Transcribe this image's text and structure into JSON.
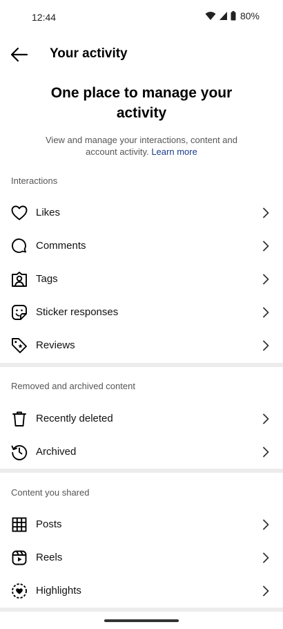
{
  "status": {
    "time": "12:44",
    "battery": "80%"
  },
  "header": {
    "title": "Your activity"
  },
  "hero": {
    "title": "One place to manage your activity",
    "description": "View and manage your interactions, content and account activity.",
    "link": "Learn more"
  },
  "sections": {
    "interactions": {
      "label": "Interactions",
      "items": [
        "Likes",
        "Comments",
        "Tags",
        "Sticker responses",
        "Reviews"
      ]
    },
    "removed": {
      "label": "Removed and archived content",
      "items": [
        "Recently deleted",
        "Archived"
      ]
    },
    "shared": {
      "label": "Content you shared",
      "items": [
        "Posts",
        "Reels",
        "Highlights"
      ]
    }
  }
}
